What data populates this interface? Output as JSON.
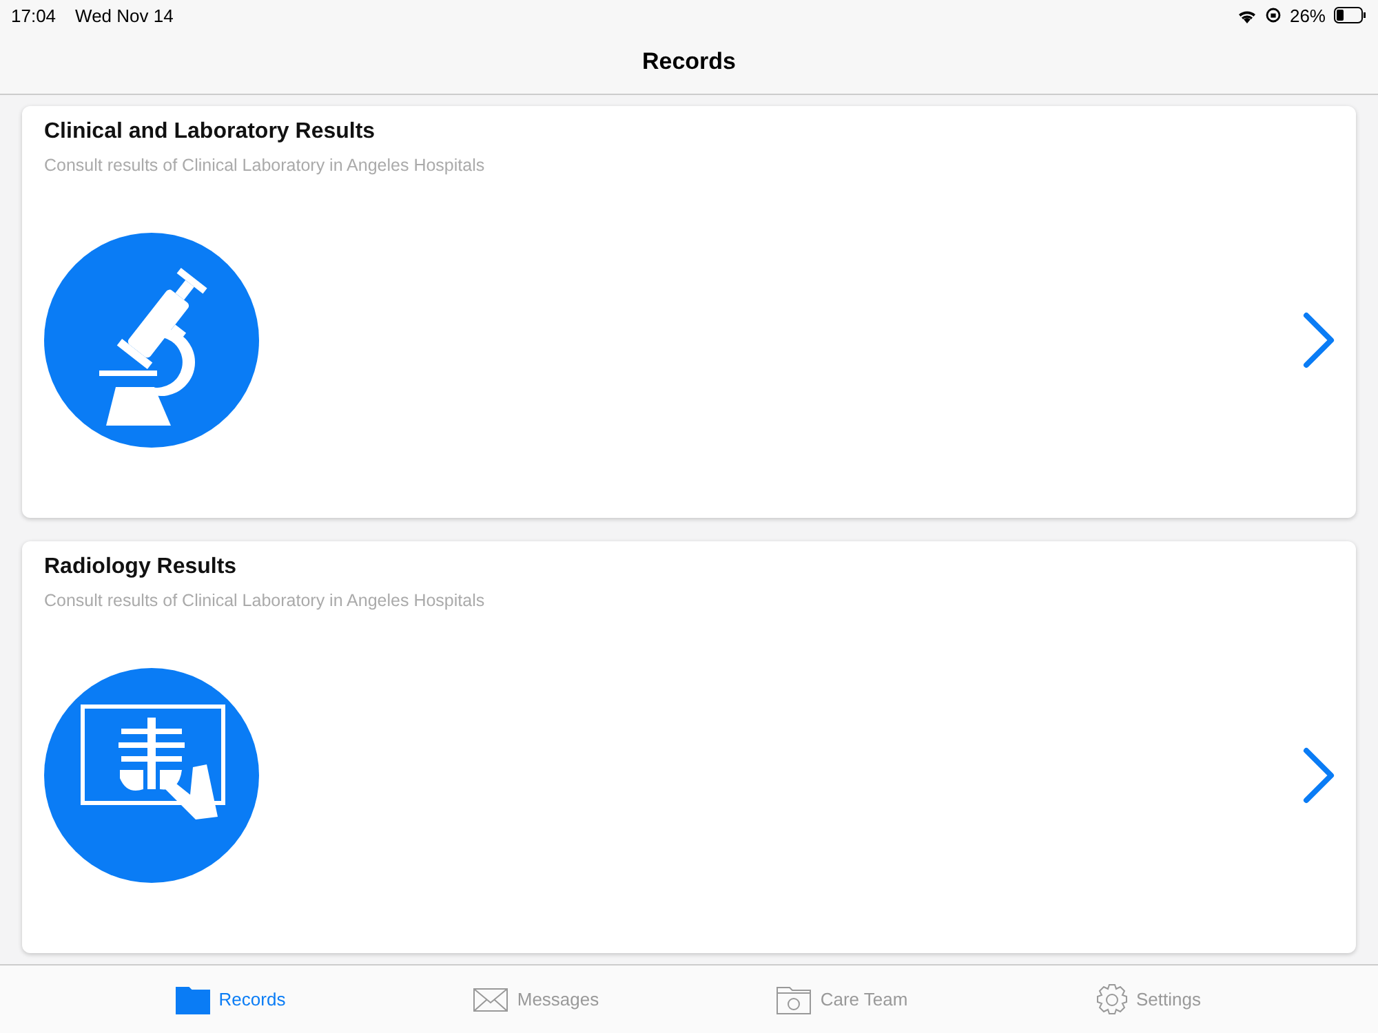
{
  "status_bar": {
    "time": "17:04",
    "date": "Wed Nov 14",
    "battery": "26%"
  },
  "nav_bar": {
    "title": "Records"
  },
  "cards": [
    {
      "kind": "microscope",
      "title": "Clinical and Laboratory Results",
      "subtitle": "Consult results of Clinical Laboratory in Angeles Hospitals"
    },
    {
      "kind": "xray",
      "title": "Radiology Results",
      "subtitle": "Consult results of Clinical Laboratory in Angeles Hospitals"
    }
  ],
  "tab_bar": [
    {
      "kind": "folder",
      "label": "Records",
      "selected": true
    },
    {
      "kind": "envelope",
      "label": "Messages",
      "selected": false
    },
    {
      "kind": "team",
      "label": "Care Team",
      "selected": false
    },
    {
      "kind": "gear",
      "label": "Settings",
      "selected": false
    }
  ]
}
